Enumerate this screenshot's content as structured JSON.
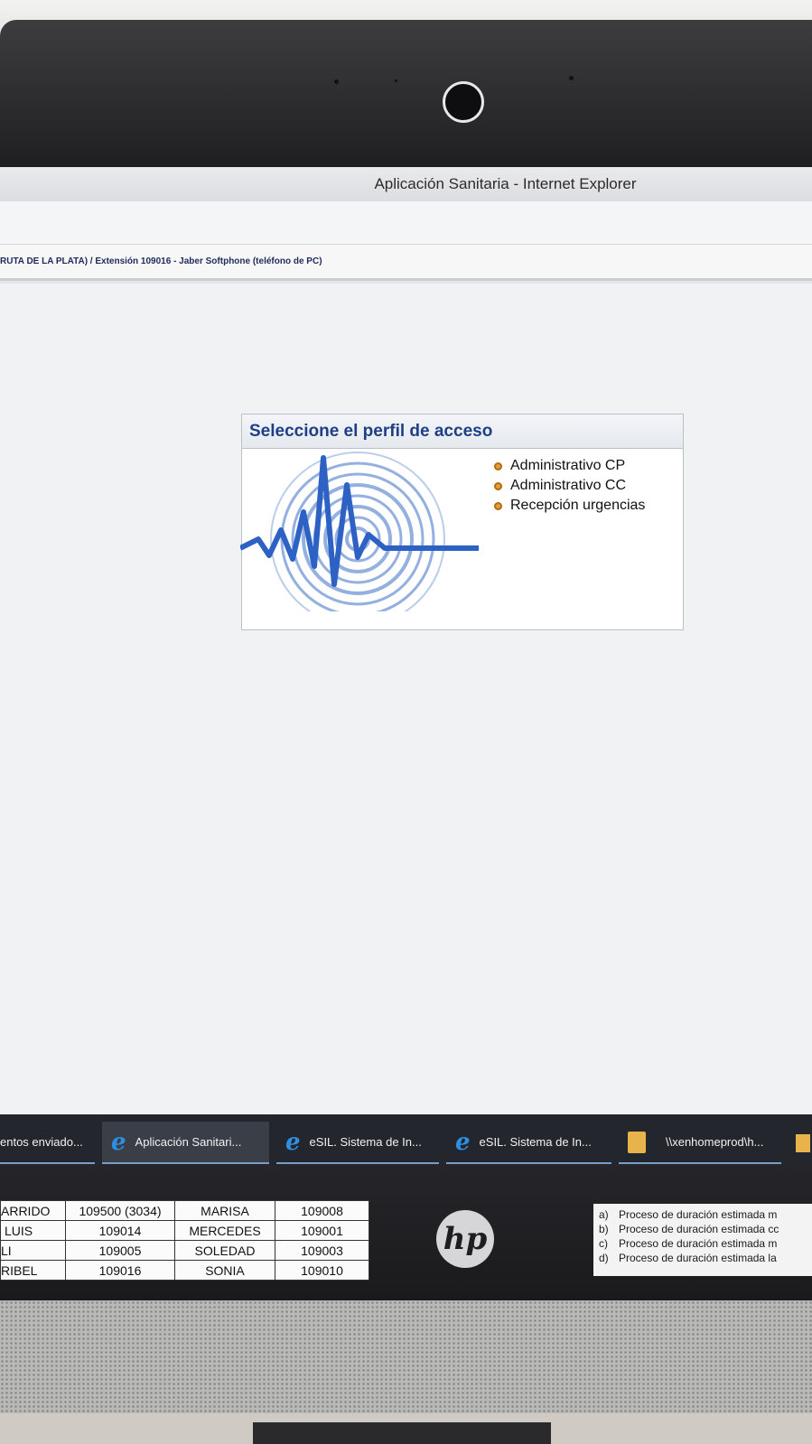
{
  "window": {
    "title": "Aplicación Sanitaria - Internet Explorer"
  },
  "info_bar": {
    "text": "RUTA DE LA PLATA) / Extensión 109016 - Jaber Softphone (teléfono de PC)"
  },
  "profile_panel": {
    "title": "Seleccione el perfil de acceso",
    "options": [
      {
        "label": "Administrativo CP"
      },
      {
        "label": "Administrativo CC"
      },
      {
        "label": "Recepción urgencias"
      }
    ]
  },
  "taskbar": {
    "items": [
      {
        "label": "entos enviado...",
        "icon": "none"
      },
      {
        "label": "Aplicación Sanitari...",
        "icon": "internet-explorer-icon"
      },
      {
        "label": "eSIL. Sistema de In...",
        "icon": "internet-explorer-icon"
      },
      {
        "label": "eSIL. Sistema de In...",
        "icon": "internet-explorer-icon"
      },
      {
        "label": "\\\\xenhomeprod\\h...",
        "icon": "folder-icon"
      }
    ]
  },
  "phone_list": {
    "rows": [
      [
        "ARRIDO",
        "109500 (3034)",
        "MARISA",
        "109008"
      ],
      [
        "LUIS",
        "109014",
        "MERCEDES",
        "109001"
      ],
      [
        "LI",
        "109005",
        "SOLEDAD",
        "109003"
      ],
      [
        "RIBEL",
        "109016",
        "SONIA",
        "109010"
      ]
    ]
  },
  "brand": {
    "logo_text": "hp"
  },
  "notes": {
    "lines": [
      {
        "letter": "a)",
        "text": "Proceso de duración estimada m"
      },
      {
        "letter": "b)",
        "text": "Proceso de duración estimada cc"
      },
      {
        "letter": "c)",
        "text": "Proceso de duración estimada m"
      },
      {
        "letter": "d)",
        "text": "Proceso de duración estimada la"
      }
    ]
  },
  "colors": {
    "panel_title": "#1e3f86",
    "bullet": "#e1a03a",
    "taskbar": "#23262c"
  }
}
